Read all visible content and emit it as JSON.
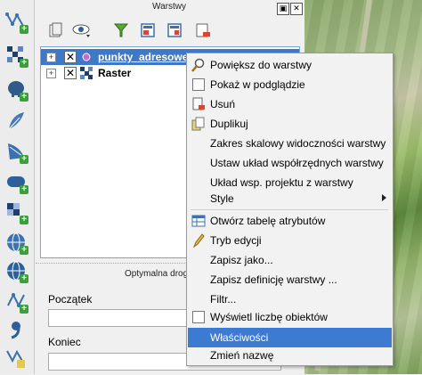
{
  "dock": {
    "title": "Warstwy"
  },
  "layers": [
    {
      "name": "punkty_adresowe",
      "visible": true,
      "selected": true,
      "expanded": false
    },
    {
      "name": "Raster",
      "visible": true,
      "selected": false,
      "expanded": false
    }
  ],
  "route_panel": {
    "title": "Optymalna drog",
    "start_label": "Początek",
    "end_label": "Koniec"
  },
  "context_menu": {
    "items": [
      {
        "label": "Powiększ do warstwy",
        "icon": "zoom-icon"
      },
      {
        "label": "Pokaż w podglądzie",
        "icon": "checkbox-icon"
      },
      {
        "label": "Usuń",
        "icon": "remove-layer-icon"
      },
      {
        "label": "Duplikuj",
        "icon": "duplicate-icon"
      },
      {
        "label": "Zakres skalowy widoczności warstwy",
        "icon": ""
      },
      {
        "label": "Ustaw układ współrzędnych warstwy",
        "icon": ""
      },
      {
        "label": "Układ wsp. projektu z warstwy",
        "icon": ""
      },
      {
        "label": "Style",
        "icon": "",
        "submenu": true
      },
      {
        "label": "Otwórz tabelę atrybutów",
        "icon": "table-icon"
      },
      {
        "label": "Tryb edycji",
        "icon": "pencil-icon"
      },
      {
        "label": "Zapisz jako...",
        "icon": ""
      },
      {
        "label": "Zapisz definicję warstwy ...",
        "icon": ""
      },
      {
        "label": "Filtr...",
        "icon": ""
      },
      {
        "label": "Wyświetl liczbę obiektów",
        "icon": "checkbox-icon"
      },
      {
        "label": "Właściwości",
        "icon": "",
        "highlighted": true
      },
      {
        "label": "Zmień nazwę",
        "icon": ""
      }
    ]
  },
  "colors": {
    "selection": "#3f78c8",
    "menu_highlight": "#3d7ad1"
  }
}
